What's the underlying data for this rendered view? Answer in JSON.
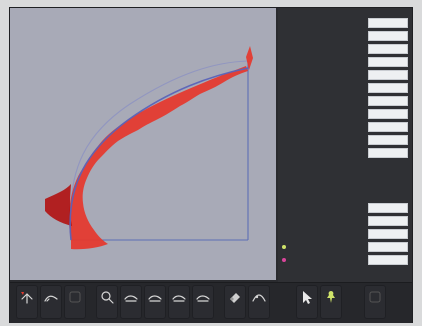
{
  "properties_panel": {
    "groups": [
      {
        "rows": [
          {
            "label": "",
            "value": ""
          },
          {
            "label": "",
            "value": ""
          },
          {
            "label": "",
            "value": ""
          },
          {
            "label": "",
            "value": ""
          },
          {
            "label": "",
            "value": ""
          },
          {
            "label": "",
            "value": ""
          },
          {
            "label": "",
            "value": ""
          },
          {
            "label": "",
            "value": ""
          },
          {
            "label": "",
            "value": ""
          },
          {
            "label": "",
            "value": ""
          },
          {
            "label": "",
            "value": ""
          }
        ]
      },
      {
        "rows": [
          {
            "label": "",
            "value": ""
          },
          {
            "label": "",
            "value": ""
          },
          {
            "label": "",
            "value": ""
          },
          {
            "label": "",
            "value": "",
            "marker_color": "#cfe36a"
          },
          {
            "label": "",
            "value": "",
            "marker_color": "#d9459b"
          }
        ]
      },
      {
        "rows": [
          {
            "label": "",
            "value": ""
          },
          {
            "label": "",
            "value": ""
          },
          {
            "label": "",
            "value": ""
          }
        ]
      }
    ]
  },
  "toolbar": {
    "buttons": [
      {
        "icon": "pan-icon",
        "label": ""
      },
      {
        "icon": "sketch-icon",
        "label": ""
      },
      {
        "icon": "blank-icon",
        "label": ""
      },
      {
        "icon": "zoom-icon",
        "label": ""
      },
      {
        "icon": "measure-icon",
        "label": ""
      },
      {
        "icon": "measure-icon",
        "label": ""
      },
      {
        "icon": "measure-icon",
        "label": ""
      },
      {
        "icon": "measure-icon",
        "label": ""
      },
      {
        "icon": "eraser-icon",
        "label": ""
      },
      {
        "icon": "curve-icon",
        "label": ""
      },
      {
        "icon": "cursor-icon",
        "label": ""
      },
      {
        "icon": "pin-icon",
        "label": ""
      },
      {
        "icon": "blank-icon",
        "label": ""
      }
    ]
  },
  "colors": {
    "canvas_bg": "#a8aab7",
    "panel_bg": "#2f3034",
    "arc_primary": "#5a63b8",
    "arc_secondary": "#7d85c8",
    "heat": "#e43a2f",
    "heat_hot": "#b11111",
    "guide": "#5a6bb6"
  }
}
